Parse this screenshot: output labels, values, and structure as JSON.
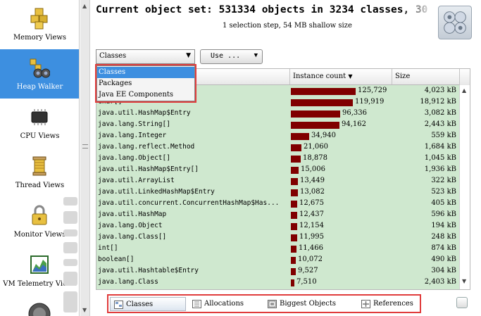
{
  "sidebar": {
    "items": [
      {
        "label": "Memory Views",
        "icon": "memory-cubes-icon",
        "active": false
      },
      {
        "label": "Heap Walker",
        "icon": "binoculars-icon",
        "active": true
      },
      {
        "label": "CPU Views",
        "icon": "cpu-chip-icon",
        "active": false
      },
      {
        "label": "Thread Views",
        "icon": "thread-spool-icon",
        "active": false
      },
      {
        "label": "Monitor Views",
        "icon": "lock-icon",
        "active": false
      },
      {
        "label": "VM Telemetry Views",
        "icon": "telemetry-chart-icon",
        "active": false
      }
    ]
  },
  "header": {
    "title": "Current object set: 531334 objects in 3234 classes, 30",
    "subtitle": "1 selection step, 54 MB shallow size"
  },
  "toolbar": {
    "view_select_value": "Classes",
    "use_button_label": "Use ..."
  },
  "dropdown": {
    "options": [
      "Classes",
      "Packages",
      "Java EE Components"
    ],
    "selected_index": 0
  },
  "table": {
    "columns": {
      "name": "",
      "instance_count": "Instance count",
      "size": "Size"
    },
    "sort_indicator": "▼",
    "max_count": 125729,
    "rows": [
      {
        "name": "",
        "count": 125729,
        "count_label": "125,729",
        "size": "4,023 kB"
      },
      {
        "name": "char[]",
        "count": 119919,
        "count_label": "119,919",
        "size": "18,912 kB"
      },
      {
        "name": "java.util.HashMap$Entry",
        "count": 96336,
        "count_label": "96,336",
        "size": "3,082 kB"
      },
      {
        "name": "java.lang.String[]",
        "count": 94162,
        "count_label": "94,162",
        "size": "2,443 kB"
      },
      {
        "name": "java.lang.Integer",
        "count": 34940,
        "count_label": "34,940",
        "size": "559 kB"
      },
      {
        "name": "java.lang.reflect.Method",
        "count": 21060,
        "count_label": "21,060",
        "size": "1,684 kB"
      },
      {
        "name": "java.lang.Object[]",
        "count": 18878,
        "count_label": "18,878",
        "size": "1,045 kB"
      },
      {
        "name": "java.util.HashMap$Entry[]",
        "count": 15006,
        "count_label": "15,006",
        "size": "1,936 kB"
      },
      {
        "name": "java.util.ArrayList",
        "count": 13449,
        "count_label": "13,449",
        "size": "322 kB"
      },
      {
        "name": "java.util.LinkedHashMap$Entry",
        "count": 13082,
        "count_label": "13,082",
        "size": "523 kB"
      },
      {
        "name": "java.util.concurrent.ConcurrentHashMap$Has...",
        "count": 12675,
        "count_label": "12,675",
        "size": "405 kB"
      },
      {
        "name": "java.util.HashMap",
        "count": 12437,
        "count_label": "12,437",
        "size": "596 kB"
      },
      {
        "name": "java.lang.Object",
        "count": 12154,
        "count_label": "12,154",
        "size": "194 kB"
      },
      {
        "name": "java.lang.Class[]",
        "count": 11995,
        "count_label": "11,995",
        "size": "248 kB"
      },
      {
        "name": "int[]",
        "count": 11466,
        "count_label": "11,466",
        "size": "874 kB"
      },
      {
        "name": "boolean[]",
        "count": 10072,
        "count_label": "10,072",
        "size": "490 kB"
      },
      {
        "name": "java.util.Hashtable$Entry",
        "count": 9527,
        "count_label": "9,527",
        "size": "304 kB"
      },
      {
        "name": "java.lang.Class",
        "count": 7510,
        "count_label": "7,510",
        "size": "2,403 kB"
      }
    ]
  },
  "bottom_tabs": [
    {
      "label": "Classes",
      "icon": "classes-icon",
      "active": true
    },
    {
      "label": "Allocations",
      "icon": "allocations-icon",
      "active": false
    },
    {
      "label": "Biggest Objects",
      "icon": "biggest-objects-icon",
      "active": false
    },
    {
      "label": "References",
      "icon": "references-icon",
      "active": false
    }
  ],
  "colors": {
    "bar": "#800000",
    "table_background": "#cfe8cf",
    "selection": "#3d8fe0",
    "highlight_border": "#e03c3c"
  }
}
